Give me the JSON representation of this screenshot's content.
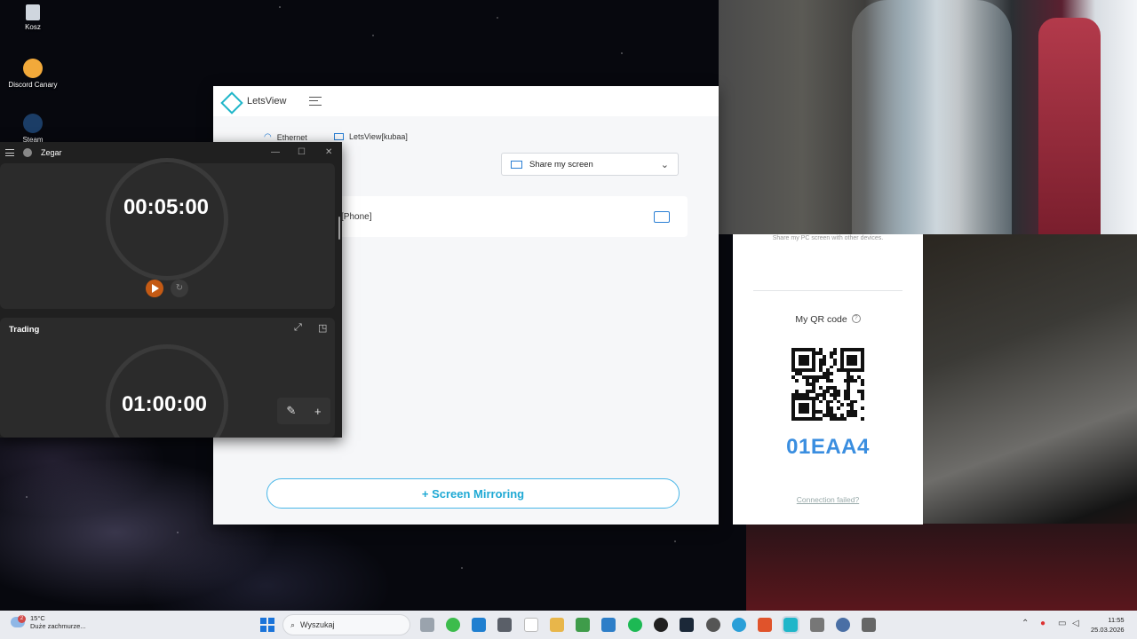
{
  "desktop": {
    "icons": [
      {
        "label": "Kosz",
        "icon": "recycle-bin-icon"
      },
      {
        "label": "Discord Canary",
        "icon": "discord-icon"
      },
      {
        "label": "Steam",
        "icon": "steam-icon"
      }
    ]
  },
  "letsview": {
    "title": "LetsView",
    "network": "Ethernet",
    "device_name": "LetsView[kubaa]",
    "share_button": "Share my screen",
    "device_item": "[Phone]",
    "mirror_button": "+ Screen Mirroring",
    "share_desc": "Share my PC screen with other devices.",
    "qr_label": "My QR code",
    "help_symbol": "?",
    "code": "01EAA4",
    "connection_failed": "Connection failed?"
  },
  "zegar": {
    "title": "Zegar",
    "timer1": "00:05:00",
    "timer2_title": "Trading",
    "timer2": "01:00:00"
  },
  "taskbar": {
    "weather_temp": "15°C",
    "weather_desc": "Duże zachmurze...",
    "weather_badge": "2",
    "search_placeholder": "Wyszukaj",
    "time": "11:55",
    "date": "25.03.2026"
  }
}
